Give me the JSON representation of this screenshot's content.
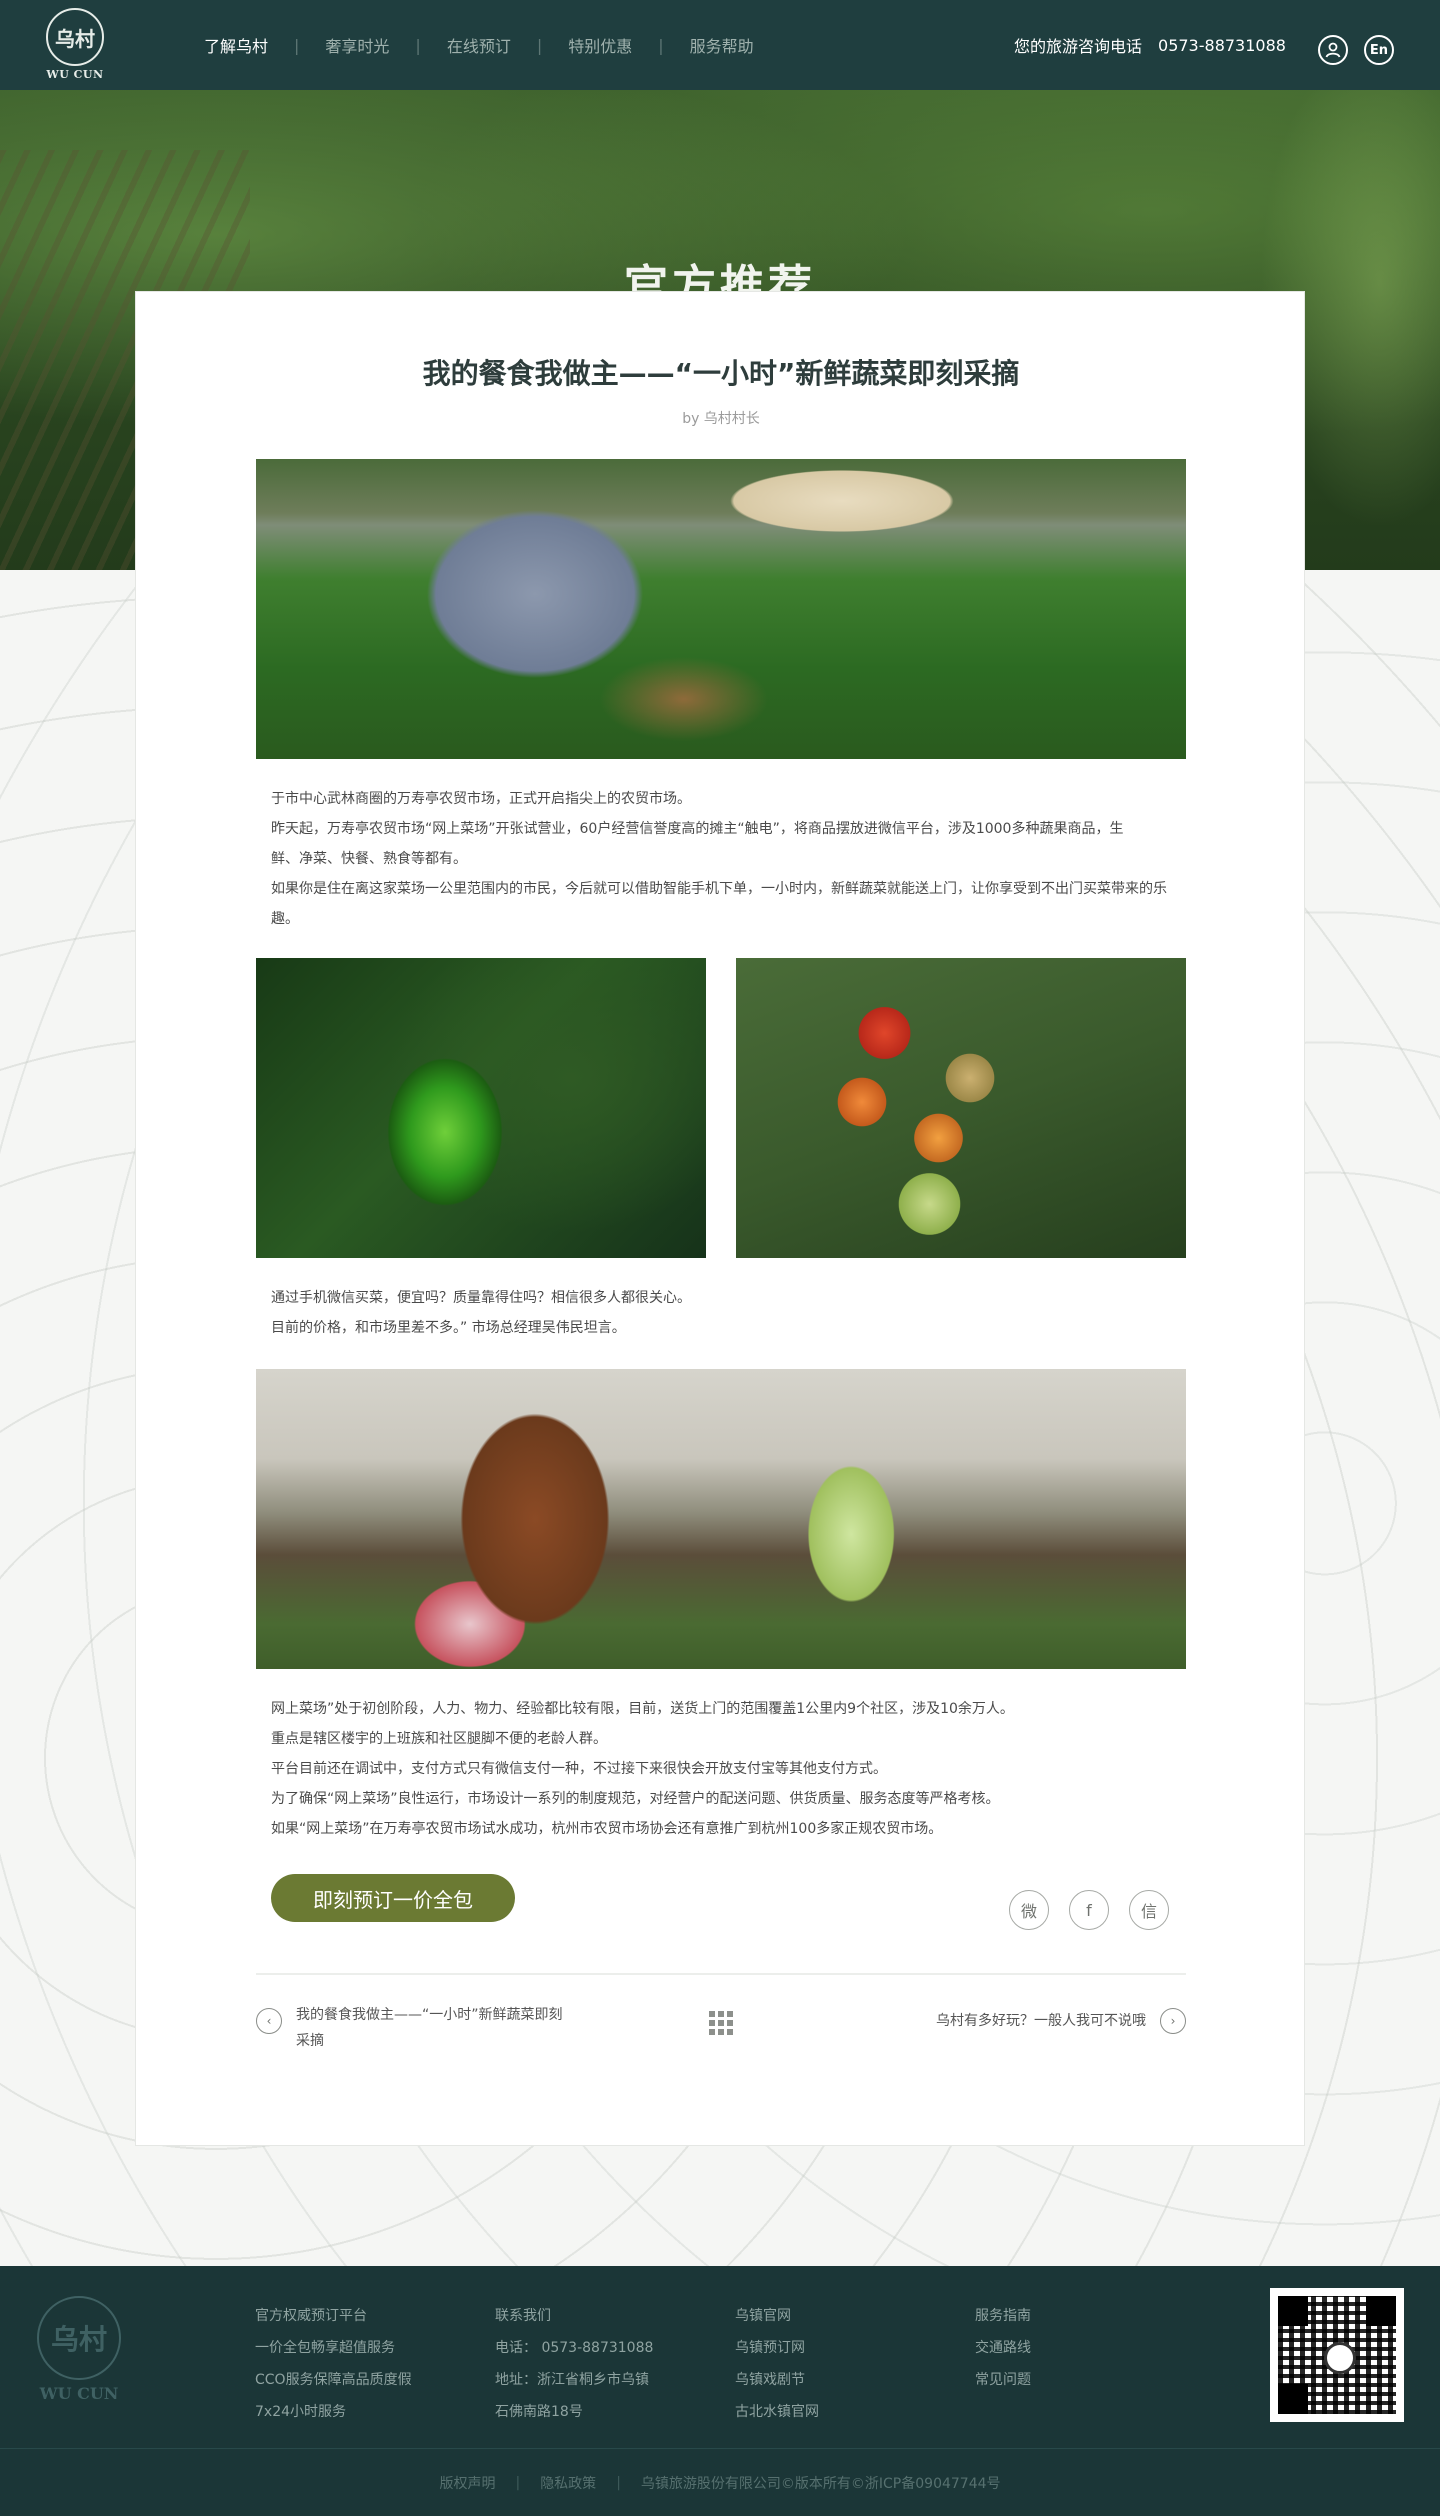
{
  "header": {
    "logo_text": "WU CUN",
    "logo_glyph": "乌村",
    "nav": [
      {
        "label": "了解乌村",
        "active": true
      },
      {
        "label": "奢享时光",
        "active": false
      },
      {
        "label": "在线预订",
        "active": false
      },
      {
        "label": "特别优惠",
        "active": false
      },
      {
        "label": "服务帮助",
        "active": false
      }
    ],
    "nav_separator": "|",
    "hotline_label": "您的旅游咨询电话",
    "hotline_number": "0573-88731088",
    "user_icon": "user-icon",
    "lang_label": "En"
  },
  "hero": {
    "title": "官方推荐"
  },
  "article": {
    "title": "我的餐食我做主——“一小时”新鲜蔬菜即刻采摘",
    "author": "by 乌村村长",
    "images": {
      "farmer": "farmer-in-field",
      "pepper": "green-pepper",
      "tomato": "tomatoes-on-vine",
      "girl": "girl-picking-cabbage"
    },
    "para1": [
      "于市中心武林商圈的万寿亭农贸市场，正式开启指尖上的农贸市场。",
      "昨天起，万寿亭农贸市场“网上菜场”开张试营业，60户经营信誉度高的摊主“触电”，将商品摆放进微信平台，涉及1000多种蔬果商品，生",
      "鲜、净菜、快餐、熟食等都有。",
      "如果你是住在离这家菜场一公里范围内的市民，今后就可以借助智能手机下单，一小时内，新鲜蔬菜就能送上门，让你享受到不出门买菜带来的乐",
      "趣。"
    ],
    "para2": [
      "通过手机微信买菜，便宜吗？质量靠得住吗？相信很多人都很关心。",
      "目前的价格，和市场里差不多。” 市场总经理吴伟民坦言。"
    ],
    "para3": [
      "网上菜场”处于初创阶段，人力、物力、经验都比较有限，目前，送货上门的范围覆盖1公里内9个社区，涉及10余万人。",
      "重点是辖区楼宇的上班族和社区腿脚不便的老龄人群。",
      "平台目前还在调试中，支付方式只有微信支付一种，不过接下来很快会开放支付宝等其他支付方式。",
      "为了确保“网上菜场”良性运行，市场设计一系列的制度规范，对经营户的配送问题、供货质量、服务态度等严格考核。",
      "如果“网上菜场”在万寿亭农贸市场试水成功，杭州市农贸市场协会还有意推广到杭州100多家正规农贸市场。"
    ],
    "book_button": "即刻预订一价全包",
    "share": {
      "weibo": "weibo-icon",
      "facebook": "facebook-icon",
      "wechat": "wechat-icon",
      "weibo_glyph": "微",
      "facebook_glyph": "f",
      "wechat_glyph": "信"
    },
    "prev_arrow": "‹",
    "next_arrow": "›",
    "prev_title": "我的餐食我做主——“一小时”新鲜蔬菜即刻采摘",
    "next_title": "乌村有多好玩？一般人我可不说哦"
  },
  "footer": {
    "logo_glyph": "乌村",
    "logo_text": "WU CUN",
    "col1": [
      "官方权威预订平台",
      "一价全包畅享超值服务",
      "CCO服务保障高品质度假",
      "7x24小时服务"
    ],
    "col2": [
      "联系我们",
      "电话： 0573-88731088",
      "地址：浙江省桐乡市乌镇",
      "石佛南路18号"
    ],
    "col3": [
      "乌镇官网",
      "乌镇预订网",
      "乌镇戏剧节",
      "古北水镇官网"
    ],
    "col4": [
      "服务指南",
      "交通路线",
      "常见问题"
    ],
    "copyright": {
      "links": [
        "版权声明",
        "隐私政策"
      ],
      "separator": "|",
      "text": "乌镇旅游股份有限公司©版本所有©浙ICP备09047744号"
    }
  },
  "colors": {
    "topbar": "#1f3e3f",
    "footer": "#1b3637",
    "button": "#6b7a33",
    "title": "#2e3d3c"
  }
}
